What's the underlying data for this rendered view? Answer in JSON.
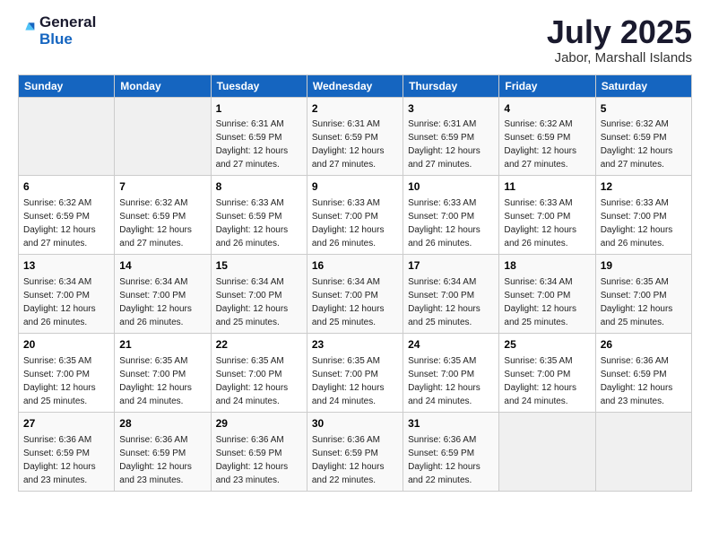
{
  "header": {
    "logo_general": "General",
    "logo_blue": "Blue",
    "month": "July 2025",
    "location": "Jabor, Marshall Islands"
  },
  "days_of_week": [
    "Sunday",
    "Monday",
    "Tuesday",
    "Wednesday",
    "Thursday",
    "Friday",
    "Saturday"
  ],
  "weeks": [
    [
      {
        "day": "",
        "info": ""
      },
      {
        "day": "",
        "info": ""
      },
      {
        "day": "1",
        "info": "Sunrise: 6:31 AM\nSunset: 6:59 PM\nDaylight: 12 hours and 27 minutes."
      },
      {
        "day": "2",
        "info": "Sunrise: 6:31 AM\nSunset: 6:59 PM\nDaylight: 12 hours and 27 minutes."
      },
      {
        "day": "3",
        "info": "Sunrise: 6:31 AM\nSunset: 6:59 PM\nDaylight: 12 hours and 27 minutes."
      },
      {
        "day": "4",
        "info": "Sunrise: 6:32 AM\nSunset: 6:59 PM\nDaylight: 12 hours and 27 minutes."
      },
      {
        "day": "5",
        "info": "Sunrise: 6:32 AM\nSunset: 6:59 PM\nDaylight: 12 hours and 27 minutes."
      }
    ],
    [
      {
        "day": "6",
        "info": "Sunrise: 6:32 AM\nSunset: 6:59 PM\nDaylight: 12 hours and 27 minutes."
      },
      {
        "day": "7",
        "info": "Sunrise: 6:32 AM\nSunset: 6:59 PM\nDaylight: 12 hours and 27 minutes."
      },
      {
        "day": "8",
        "info": "Sunrise: 6:33 AM\nSunset: 6:59 PM\nDaylight: 12 hours and 26 minutes."
      },
      {
        "day": "9",
        "info": "Sunrise: 6:33 AM\nSunset: 7:00 PM\nDaylight: 12 hours and 26 minutes."
      },
      {
        "day": "10",
        "info": "Sunrise: 6:33 AM\nSunset: 7:00 PM\nDaylight: 12 hours and 26 minutes."
      },
      {
        "day": "11",
        "info": "Sunrise: 6:33 AM\nSunset: 7:00 PM\nDaylight: 12 hours and 26 minutes."
      },
      {
        "day": "12",
        "info": "Sunrise: 6:33 AM\nSunset: 7:00 PM\nDaylight: 12 hours and 26 minutes."
      }
    ],
    [
      {
        "day": "13",
        "info": "Sunrise: 6:34 AM\nSunset: 7:00 PM\nDaylight: 12 hours and 26 minutes."
      },
      {
        "day": "14",
        "info": "Sunrise: 6:34 AM\nSunset: 7:00 PM\nDaylight: 12 hours and 26 minutes."
      },
      {
        "day": "15",
        "info": "Sunrise: 6:34 AM\nSunset: 7:00 PM\nDaylight: 12 hours and 25 minutes."
      },
      {
        "day": "16",
        "info": "Sunrise: 6:34 AM\nSunset: 7:00 PM\nDaylight: 12 hours and 25 minutes."
      },
      {
        "day": "17",
        "info": "Sunrise: 6:34 AM\nSunset: 7:00 PM\nDaylight: 12 hours and 25 minutes."
      },
      {
        "day": "18",
        "info": "Sunrise: 6:34 AM\nSunset: 7:00 PM\nDaylight: 12 hours and 25 minutes."
      },
      {
        "day": "19",
        "info": "Sunrise: 6:35 AM\nSunset: 7:00 PM\nDaylight: 12 hours and 25 minutes."
      }
    ],
    [
      {
        "day": "20",
        "info": "Sunrise: 6:35 AM\nSunset: 7:00 PM\nDaylight: 12 hours and 25 minutes."
      },
      {
        "day": "21",
        "info": "Sunrise: 6:35 AM\nSunset: 7:00 PM\nDaylight: 12 hours and 24 minutes."
      },
      {
        "day": "22",
        "info": "Sunrise: 6:35 AM\nSunset: 7:00 PM\nDaylight: 12 hours and 24 minutes."
      },
      {
        "day": "23",
        "info": "Sunrise: 6:35 AM\nSunset: 7:00 PM\nDaylight: 12 hours and 24 minutes."
      },
      {
        "day": "24",
        "info": "Sunrise: 6:35 AM\nSunset: 7:00 PM\nDaylight: 12 hours and 24 minutes."
      },
      {
        "day": "25",
        "info": "Sunrise: 6:35 AM\nSunset: 7:00 PM\nDaylight: 12 hours and 24 minutes."
      },
      {
        "day": "26",
        "info": "Sunrise: 6:36 AM\nSunset: 6:59 PM\nDaylight: 12 hours and 23 minutes."
      }
    ],
    [
      {
        "day": "27",
        "info": "Sunrise: 6:36 AM\nSunset: 6:59 PM\nDaylight: 12 hours and 23 minutes."
      },
      {
        "day": "28",
        "info": "Sunrise: 6:36 AM\nSunset: 6:59 PM\nDaylight: 12 hours and 23 minutes."
      },
      {
        "day": "29",
        "info": "Sunrise: 6:36 AM\nSunset: 6:59 PM\nDaylight: 12 hours and 23 minutes."
      },
      {
        "day": "30",
        "info": "Sunrise: 6:36 AM\nSunset: 6:59 PM\nDaylight: 12 hours and 22 minutes."
      },
      {
        "day": "31",
        "info": "Sunrise: 6:36 AM\nSunset: 6:59 PM\nDaylight: 12 hours and 22 minutes."
      },
      {
        "day": "",
        "info": ""
      },
      {
        "day": "",
        "info": ""
      }
    ]
  ]
}
